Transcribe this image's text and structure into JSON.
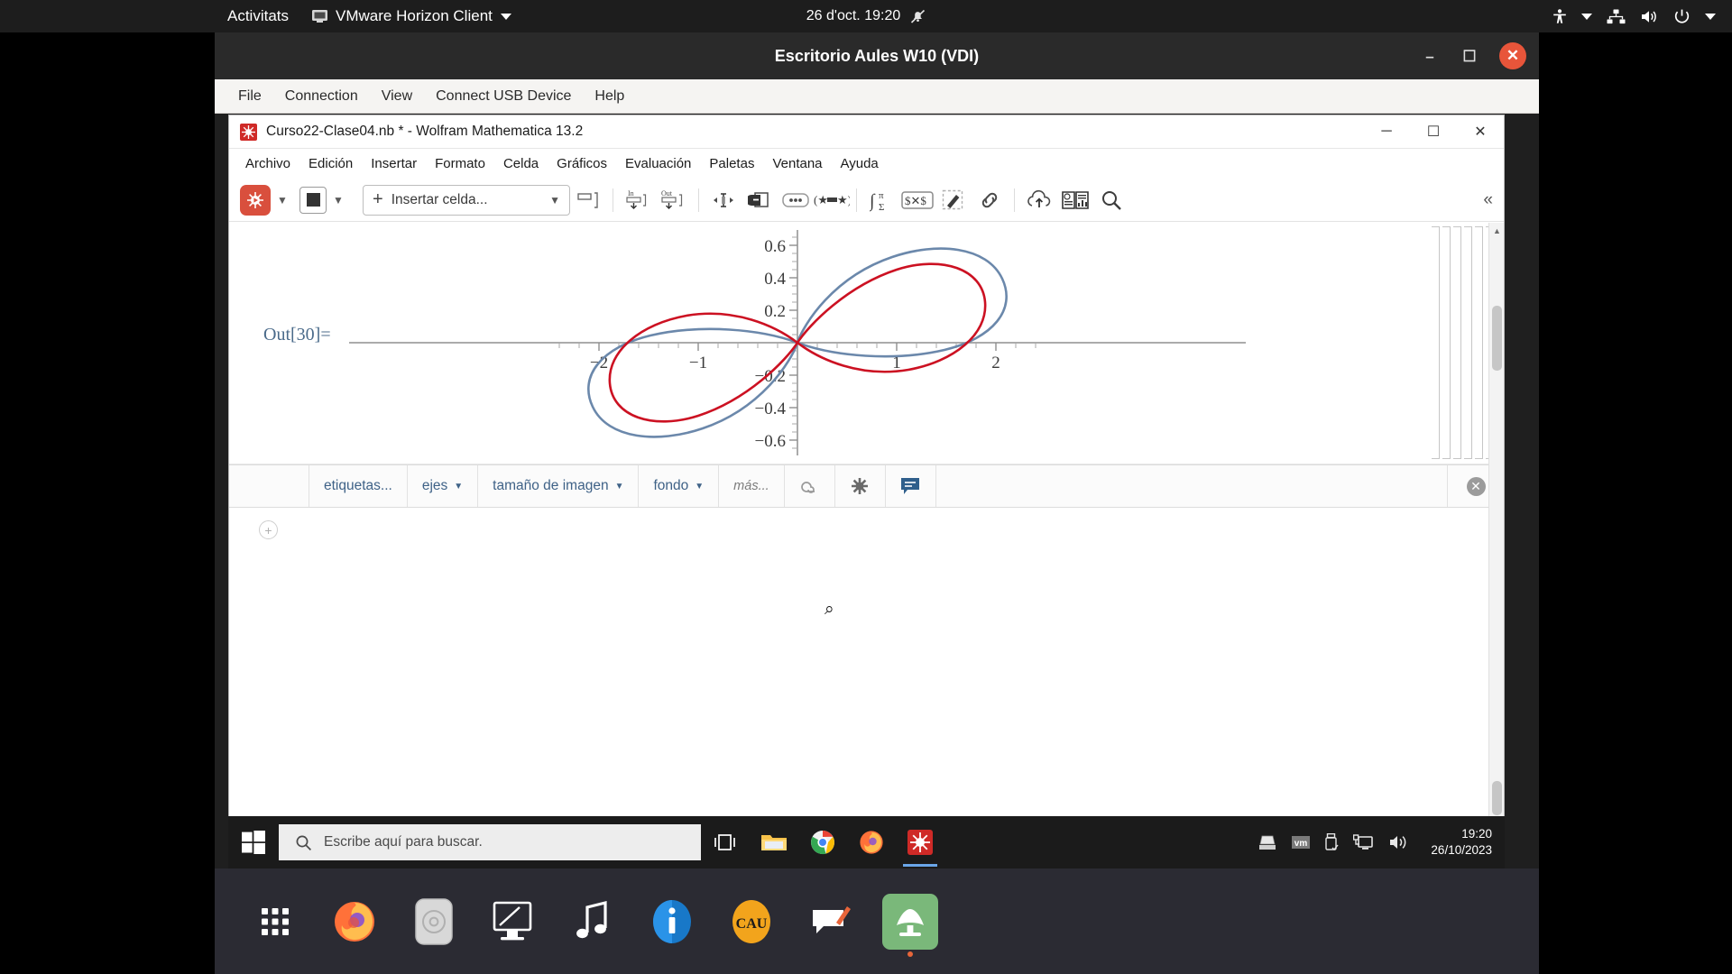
{
  "gnome": {
    "activities": "Activitats",
    "app_menu": "VMware Horizon Client",
    "datetime": "26 d'oct.  19:20",
    "icons": [
      "monitor-icon",
      "chevron-down-icon",
      "bell-muted-icon",
      "accessibility-icon",
      "chevron-down-icon",
      "network-icon",
      "volume-icon",
      "power-icon",
      "chevron-down-icon"
    ]
  },
  "vmware": {
    "title": "Escritorio Aules W10 (VDI)",
    "menu": [
      "File",
      "Connection",
      "View",
      "Connect USB Device",
      "Help"
    ],
    "minimize": "–",
    "maximize": "☐",
    "close": "✕"
  },
  "mathematica": {
    "title": "Curso22-Clase04.nb * - Wolfram Mathematica 13.2",
    "window_controls": {
      "minimize": "─",
      "maximize": "☐",
      "close": "✕"
    },
    "menu": [
      "Archivo",
      "Edición",
      "Insertar",
      "Formato",
      "Celda",
      "Gráficos",
      "Evaluación",
      "Paletas",
      "Ventana",
      "Ayuda"
    ],
    "toolbar": {
      "insert_cell_label": "Insertar celda...",
      "plus": "+",
      "icons": [
        "run-evaluate-icon",
        "chevron-down-icon",
        "stop-icon",
        "chevron-down-icon",
        "cell-bracket-icon",
        "input-cell-icon",
        "output-cell-icon",
        "text-cursor-icon",
        "copy-cell-icon",
        "more-options-icon",
        "decorations-icon",
        "math-assistant-icon",
        "dollar-x-icon",
        "pen-annotate-icon",
        "link-icon",
        "cloud-upload-icon",
        "documentation-icon",
        "search-icon",
        "collapse-toolbar-icon"
      ]
    },
    "output_label": "Out[30]=",
    "suggestions": {
      "items": [
        {
          "label": "etiquetas...",
          "has_arrow": false
        },
        {
          "label": "ejes",
          "has_arrow": true
        },
        {
          "label": "tamaño de imagen",
          "has_arrow": true
        },
        {
          "label": "fondo",
          "has_arrow": true
        },
        {
          "label": "más...",
          "has_arrow": false
        }
      ],
      "icon_buttons": [
        "spiral-undo-icon",
        "sunburst-icon",
        "comment-bubble-icon"
      ],
      "close": "✕"
    },
    "new_cell_plus": "+",
    "colors": {
      "curve_blue": "#6b88ab",
      "curve_red": "#cc1122",
      "accent_red": "#d94f3d",
      "out_label": "#4a6a8a",
      "suggestion_text": "#3f6287"
    }
  },
  "chart_data": {
    "type": "line",
    "title": "",
    "xlabel": "",
    "ylabel": "",
    "xlim": [
      -2.25,
      2.25
    ],
    "ylim": [
      -0.72,
      0.72
    ],
    "xticks": [
      -2,
      -1,
      1,
      2
    ],
    "xtick_labels": [
      "-2",
      "-1",
      "1",
      "2"
    ],
    "yticks": [
      -0.6,
      -0.4,
      -0.2,
      0.2,
      0.4,
      0.6
    ],
    "ytick_labels": [
      "-0.6",
      "-0.4",
      "-0.2",
      "0.2",
      "0.4",
      "0.6"
    ],
    "grid": false,
    "legend": "none",
    "axes_origin": [
      0,
      0
    ],
    "description": "Two superimposed lemniscate (figure-eight) curves crossing at the origin",
    "series": [
      {
        "name": "lemniscate-blue",
        "color": "#6b88ab",
        "x_extent": [
          -2.05,
          2.05
        ],
        "y_extent": [
          -0.65,
          0.65
        ],
        "shape": "lemniscate",
        "a": 2.05,
        "b": 0.65
      },
      {
        "name": "lemniscate-red",
        "color": "#cc1122",
        "x_extent": [
          -1.83,
          1.83
        ],
        "y_extent": [
          -0.56,
          0.56
        ],
        "shape": "lemniscate",
        "a": 1.83,
        "b": 0.56
      }
    ]
  },
  "windows_taskbar": {
    "start": "windows-logo-icon",
    "search_placeholder": "Escribe aquí para buscar.",
    "search_icon": "search-icon",
    "pinned": [
      "task-view-icon",
      "file-explorer-icon",
      "chrome-icon",
      "firefox-icon",
      "mathematica-icon"
    ],
    "tray": [
      "scanner-icon",
      "vm-icon",
      "usb-icon",
      "network-icon",
      "volume-icon"
    ],
    "time": "19:20",
    "date": "26/10/2023"
  },
  "ubuntu_dock": {
    "items": [
      "show-applications-icon",
      "firefox-icon",
      "disc-icon",
      "remote-desktop-icon",
      "music-icon",
      "info-icon",
      "cau-icon",
      "feedback-icon",
      "vmware-horizon-icon"
    ]
  }
}
